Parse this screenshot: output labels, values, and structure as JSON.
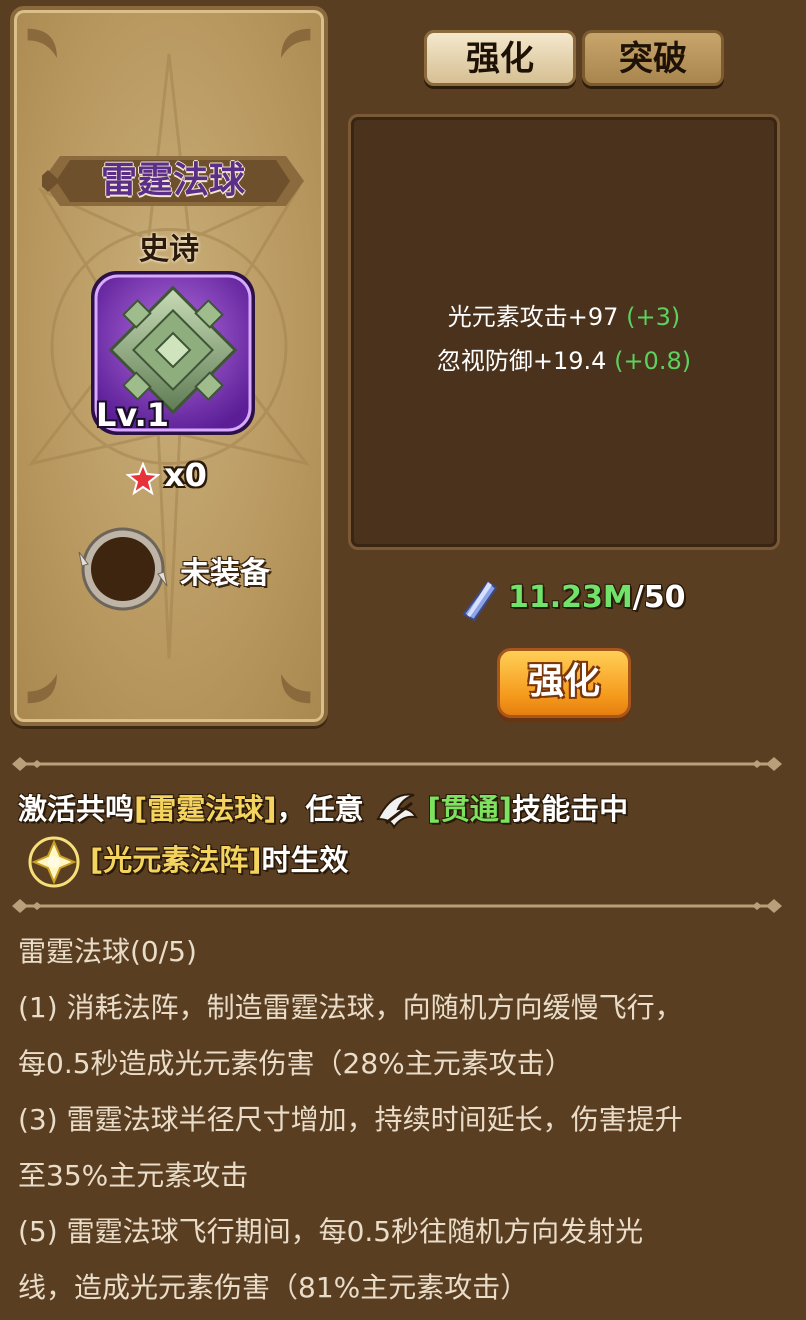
{
  "tabs": [
    {
      "label": "强化",
      "active": true
    },
    {
      "label": "突破",
      "active": false
    }
  ],
  "item": {
    "name": "雷霆法球",
    "rarity": "史诗",
    "level": "Lv.1",
    "stars": "x0",
    "equip_status": "未装备",
    "icon": "green-ornate-cube-icon"
  },
  "stats": [
    {
      "label": "光元素攻击+97",
      "inc": "(+3)"
    },
    {
      "label": "忽视防御+19.4",
      "inc": "(+0.8)"
    }
  ],
  "cost": {
    "have": "11.23M",
    "need": "/50",
    "icon": "crystal-shard-icon"
  },
  "upgrade_button": "强化",
  "resonance": {
    "line1_prefix": "激活共鸣",
    "line1_item": "[雷霆法球]",
    "line1_mid": "，任意",
    "line1_skill": "[贯通]",
    "line1_suffix": "技能击中",
    "line2_aura": "[光元素法阵]",
    "line2_suffix": "时生效"
  },
  "description": {
    "title": "雷霆法球(0/5)",
    "lines": [
      " (1) 消耗法阵，制造雷霆法球，向随机方向缓慢飞行，",
      "每0.5秒造成光元素伤害（28%主元素攻击）",
      " (3) 雷霆法球半径尺寸增加，持续时间延长，伤害提升",
      "至35%主元素攻击",
      " (5) 雷霆法球飞行期间，每0.5秒往随机方向发射光",
      "线，造成光元素伤害（81%主元素攻击）"
    ]
  },
  "colors": {
    "background": "#5a3e22",
    "card": "#b8985f",
    "name_purple": "#5b2f87",
    "stat_increase": "#5ed05e",
    "cost_have": "#72e36a",
    "highlight_yellow": "#f4d35e",
    "highlight_green": "#7ce35e",
    "button_orange": "#f59a1c"
  }
}
